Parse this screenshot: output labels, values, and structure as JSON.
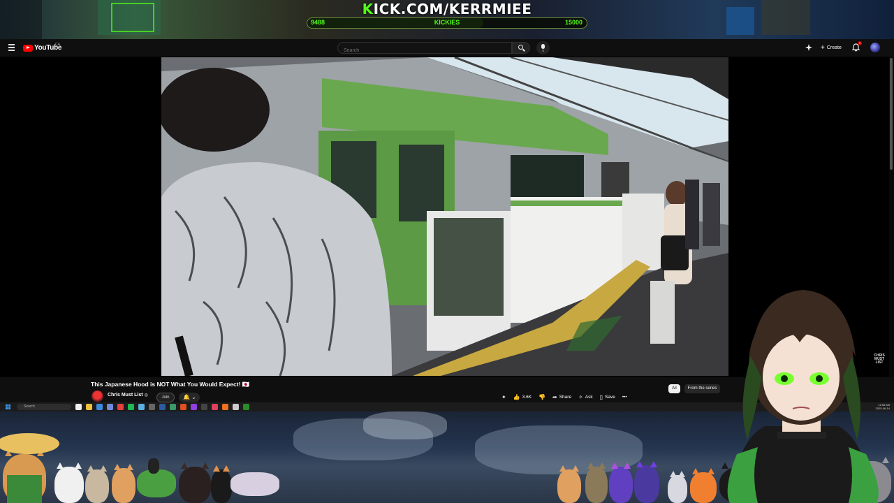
{
  "overlay": {
    "kick_title_k": "K",
    "kick_title_rest": "ICK.COM/KERRMIEE",
    "kickies_current": "9488",
    "kickies_label": "KICKIES",
    "kickies_goal": "15000",
    "goal_progress": 0.63
  },
  "header": {
    "logo_text": "YouTube",
    "country": "CA",
    "search_placeholder": "Search",
    "create_label": "Create",
    "notification_count": "9"
  },
  "video": {
    "title": "This Japanese Hood is NOT What You Would Expect! 🇯🇵",
    "channel_name": "Chris Must List",
    "verified": "◎",
    "join_label": "Join",
    "subscribe_bell": "🔔 ⌄",
    "watermark": "CHRIS MUST LIST"
  },
  "actions": {
    "likes": "3.6K",
    "share_label": "Share",
    "ask_label": "Ask",
    "save_label": "Save",
    "more_label": "•••"
  },
  "chips": {
    "all": "All",
    "series": "From the series"
  },
  "taskbar": {
    "search_label": "Search",
    "time": "11:55 AM",
    "date": "2025-06-14"
  },
  "colors": {
    "kick_green": "#53fc18",
    "yt_red": "#ff0000",
    "yt_bg": "#0f0f0f"
  }
}
